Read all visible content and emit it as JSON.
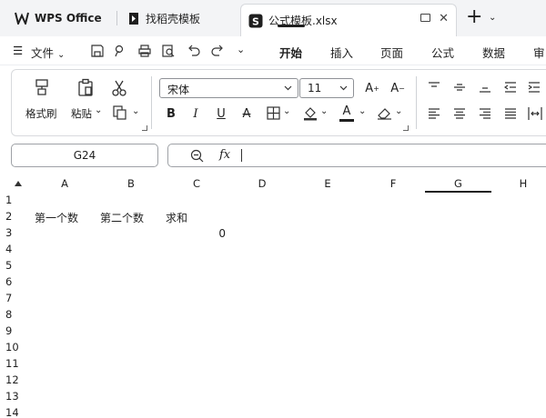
{
  "titlebar": {
    "app_name": "WPS Office",
    "find_template_tab": "找稻壳模板",
    "document_tab": "公式模板.xlsx",
    "doc_icon_letter": "S"
  },
  "menubar": {
    "file_label": "文件",
    "tabs": [
      "开始",
      "插入",
      "页面",
      "公式",
      "数据",
      "审"
    ],
    "active_tab": "开始"
  },
  "ribbon": {
    "format_painter": "格式刷",
    "paste": "粘贴",
    "font_name": "宋体",
    "font_size": "11",
    "bold": "B",
    "italic": "I",
    "underline": "U",
    "font_color_letter": "A"
  },
  "formula_bar": {
    "name_box": "G24",
    "fx_label": "fx",
    "formula": ""
  },
  "sheet": {
    "columns": [
      "A",
      "B",
      "C",
      "D",
      "E",
      "F",
      "G",
      "H"
    ],
    "rows": [
      "1",
      "2",
      "3",
      "4",
      "5",
      "6",
      "7",
      "8",
      "9",
      "10",
      "11",
      "12",
      "13",
      "14"
    ],
    "cells": {
      "A2": "第一个数",
      "B2": "第二个数",
      "C2": "求和",
      "C3": "0"
    },
    "selected_column": "G"
  },
  "colors": {
    "titlebar_bg": "#f3f4f6",
    "text": "#1f1f1f",
    "border": "#d8dadd"
  }
}
